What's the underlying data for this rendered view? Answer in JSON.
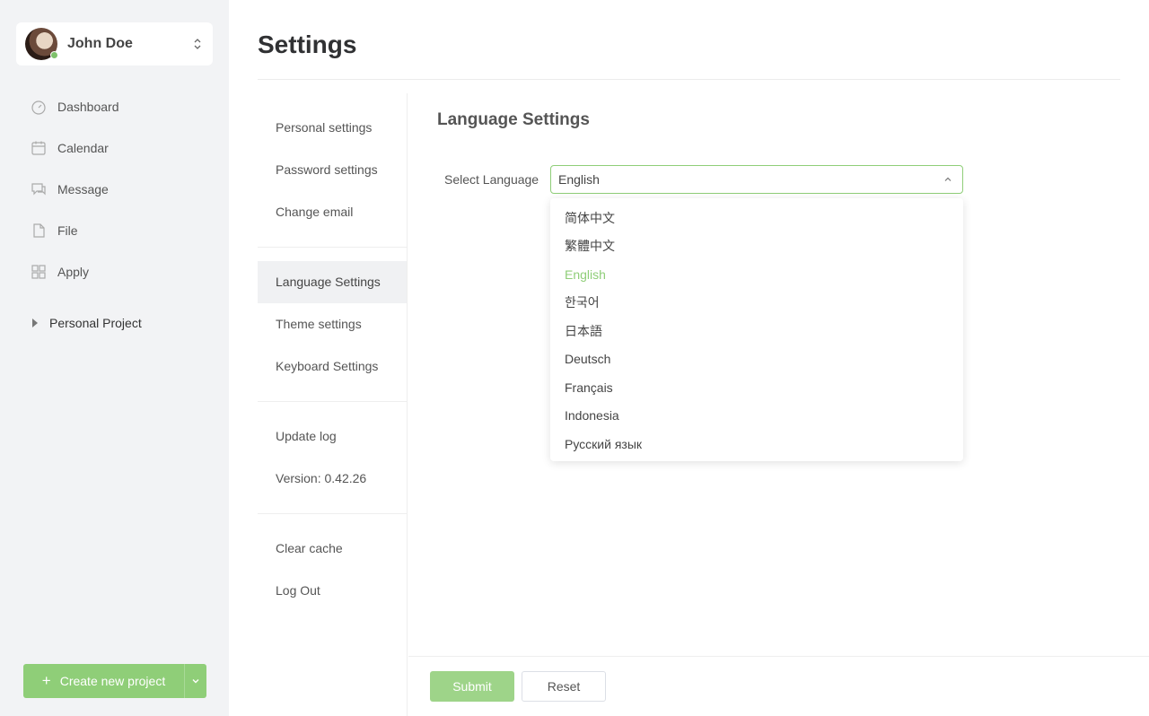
{
  "user": {
    "name": "John Doe",
    "status_color": "#7ec16a"
  },
  "nav": [
    {
      "label": "Dashboard",
      "icon": "dashboard-icon"
    },
    {
      "label": "Calendar",
      "icon": "calendar-icon"
    },
    {
      "label": "Message",
      "icon": "message-icon"
    },
    {
      "label": "File",
      "icon": "file-icon"
    },
    {
      "label": "Apply",
      "icon": "apps-icon"
    }
  ],
  "project_group": {
    "label": "Personal Project"
  },
  "create_button": {
    "label": "Create new project"
  },
  "page": {
    "title": "Settings"
  },
  "settings_menu": {
    "personal": "Personal settings",
    "password": "Password settings",
    "email": "Change email",
    "language": "Language Settings",
    "theme": "Theme settings",
    "keyboard": "Keyboard Settings",
    "update_log": "Update log",
    "version": "Version: 0.42.26",
    "clear_cache": "Clear cache",
    "logout": "Log Out"
  },
  "language": {
    "section_title": "Language Settings",
    "field_label": "Select Language",
    "selected": "English",
    "options": [
      "简体中文",
      "繁體中文",
      "English",
      "한국어",
      "日本語",
      "Deutsch",
      "Français",
      "Indonesia",
      "Русский язык"
    ]
  },
  "actions": {
    "submit": "Submit",
    "reset": "Reset"
  },
  "colors": {
    "accent": "#8fce78",
    "sidebar_bg": "#f2f3f5"
  }
}
